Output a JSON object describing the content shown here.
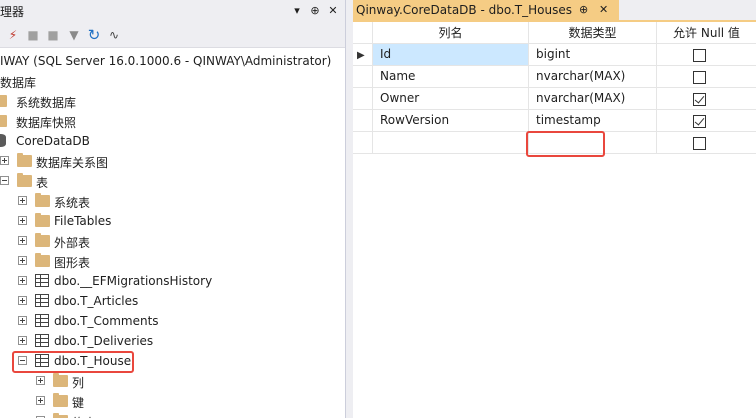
{
  "explorer": {
    "title": "理器",
    "connection": "IWAY (SQL Server 16.0.1000.6 - QINWAY\\Administrator)",
    "databases_label": "数据库",
    "system_db": "系统数据库",
    "db_snapshots": "数据库快照",
    "current_db": "CoreDataDB",
    "db_diagrams": "数据库关系图",
    "tables_label": "表",
    "system_tables": "系统表",
    "filetables": "FileTables",
    "external_tables": "外部表",
    "graph_tables": "图形表",
    "tables": [
      "dbo.__EFMigrationsHistory",
      "dbo.T_Articles",
      "dbo.T_Comments",
      "dbo.T_Deliveries",
      "dbo.T_House"
    ],
    "columns_label": "列",
    "keys_label": "键",
    "partial_label": "约束"
  },
  "document": {
    "tab_title": "Qinway.CoreDataDB - dbo.T_Houses",
    "pin_icon": "⊕",
    "close_icon": "✕"
  },
  "designer": {
    "headers": {
      "name": "列名",
      "type": "数据类型",
      "nulls": "允许 Null 值"
    },
    "rows": [
      {
        "name": "Id",
        "type": "bigint",
        "allow_null": false
      },
      {
        "name": "Name",
        "type": "nvarchar(MAX)",
        "allow_null": false
      },
      {
        "name": "Owner",
        "type": "nvarchar(MAX)",
        "allow_null": true
      },
      {
        "name": "RowVersion",
        "type": "timestamp",
        "allow_null": true
      },
      {
        "name": "",
        "type": "",
        "allow_null": false
      }
    ]
  },
  "colors": {
    "highlight": "#e9473d",
    "tab_active": "#f5cc84",
    "selected_cell": "#cce8ff"
  }
}
